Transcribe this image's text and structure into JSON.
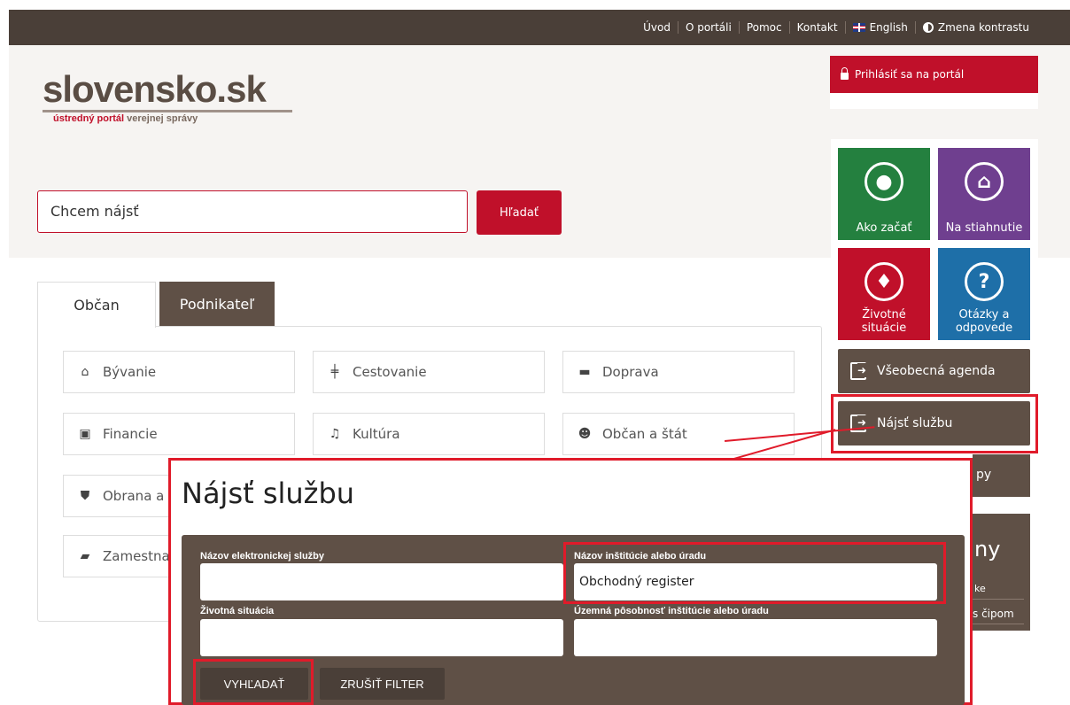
{
  "topnav": {
    "items": [
      "Úvod",
      "O portáli",
      "Pomoc",
      "Kontakt",
      "English",
      "Zmena kontrastu"
    ],
    "icons": {
      "english": "uk-flag-icon",
      "contrast": "contrast-icon"
    }
  },
  "logo": {
    "main": "slovensko.sk",
    "sub_red": "ústredný portál",
    "sub_brown": "verejnej správy"
  },
  "search": {
    "value": "Chcem nájsť",
    "button": "Hľadať"
  },
  "login": {
    "label": "Prihlásiť sa na portál",
    "icon": "lock-icon"
  },
  "tiles": [
    {
      "label": "Ako začať",
      "icon": "lightbulb-icon",
      "color": "#24803f"
    },
    {
      "label": "Na stiahnutie",
      "icon": "house-person-icon",
      "color": "#6f3f8f"
    },
    {
      "label_line1": "Životné",
      "label_line2": "situácie",
      "icon": "person-sign-icon",
      "color": "#c0102a"
    },
    {
      "label_line1": "Otázky a",
      "label_line2": "odpovede",
      "icon": "question-icon",
      "color": "#1e6fa8"
    }
  ],
  "side_buttons": {
    "agenda": "Všeobecná agenda",
    "najst": "Nájsť službu",
    "behind_partial": "py",
    "behind_big": "ny",
    "behind_s1": "ke",
    "behind_s2": "s čipom"
  },
  "tabs": {
    "obcan": "Občan",
    "podnikatel": "Podnikateľ"
  },
  "categories": [
    {
      "label": "Bývanie",
      "icon": "home-icon"
    },
    {
      "label": "Cestovanie",
      "icon": "signpost-icon"
    },
    {
      "label": "Doprava",
      "icon": "car-icon"
    },
    {
      "label": "Financie",
      "icon": "money-icon"
    },
    {
      "label": "Kultúra",
      "icon": "music-icon"
    },
    {
      "label": "Občan a štát",
      "icon": "users-icon"
    },
    {
      "label": "Obrana a",
      "icon": "shield-icon"
    },
    {
      "label": "Zamestna",
      "icon": "briefcase-icon"
    }
  ],
  "popup": {
    "title": "Nájsť službu",
    "fields": {
      "nazov_sluzby_label": "Názov elektronickej služby",
      "nazov_sluzby_value": "",
      "institucia_label": "Názov inštitúcie alebo úradu",
      "institucia_value": "Obchodný register",
      "situacia_label": "Životná situácia",
      "situacia_value": "",
      "posobnost_label": "Územná pôsobnosť inštitúcie alebo úradu",
      "posobnost_value": ""
    },
    "buttons": {
      "search": "VYHĽADAŤ",
      "clear": "ZRUŠIŤ FILTER"
    }
  },
  "colors": {
    "brown": "#5f5046",
    "dark_brown": "#4a3f38",
    "red": "#c0102a",
    "highlight": "#e01b2a"
  }
}
